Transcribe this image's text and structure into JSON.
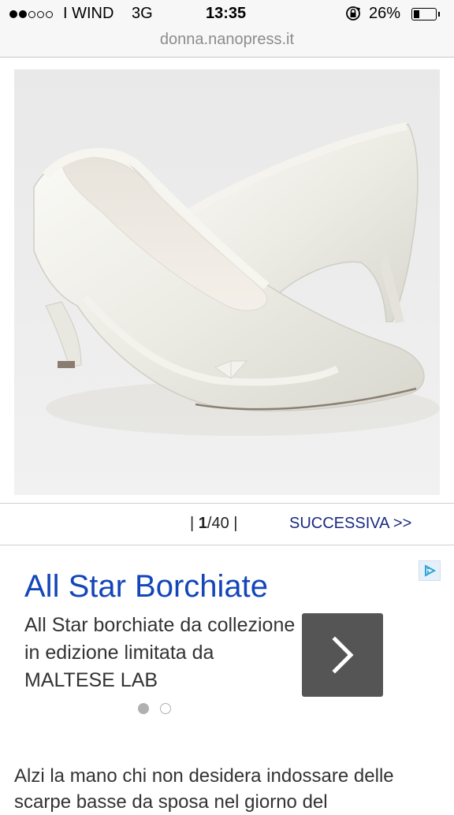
{
  "status": {
    "signal_bars": 2,
    "carrier": "WIND",
    "network": "3G",
    "time": "13:35",
    "battery_percent": "26%",
    "battery_level": 0.26
  },
  "browser": {
    "url": "donna.nanopress.it"
  },
  "gallery": {
    "current": "1",
    "total": "/40 |",
    "prefix": "| ",
    "next_label": "SUCCESSIVA >>"
  },
  "ad": {
    "title": "All Star Borchiate",
    "description": "All Star borchiate da collezione in edizione limitata da MALTESE LAB",
    "dots_active": 0
  },
  "article": {
    "text": "Alzi la mano chi non desidera indossare delle scarpe basse da sposa nel giorno del"
  },
  "colors": {
    "ad_title": "#1346b8",
    "next_link": "#1a2a80",
    "ad_button": "#555555"
  }
}
